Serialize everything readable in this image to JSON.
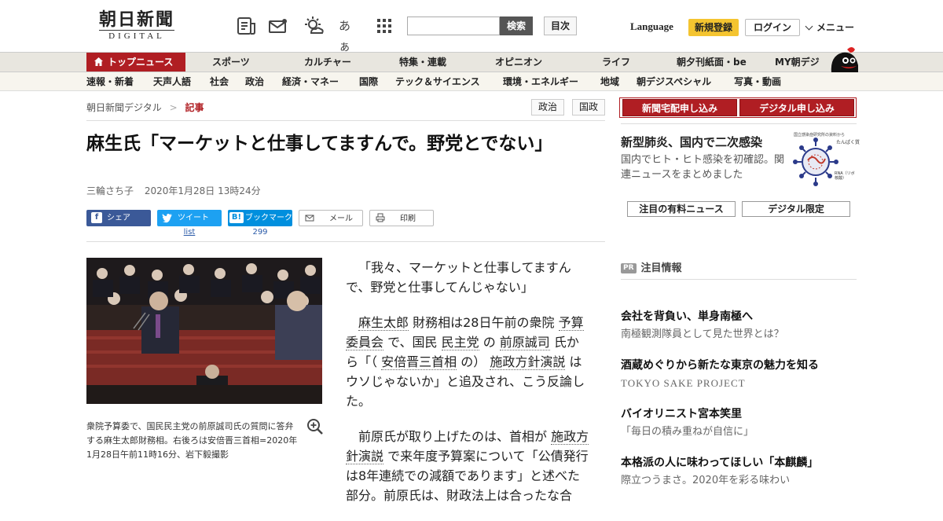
{
  "header": {
    "logo_jp": "朝日新聞",
    "logo_en": "DIGITAL",
    "icons": [
      "newspaper-icon",
      "mail-icon",
      "weather-icon",
      "font-size-icon",
      "grid-menu-icon"
    ],
    "font_icon_text": "あぁ",
    "search_placeholder": "",
    "search_label": "検索",
    "index_label": "目次",
    "language_label": "Language",
    "signup_label": "新規登録",
    "login_label": "ログイン",
    "menu_label": "メニュー"
  },
  "nav_primary": {
    "top": "トップニュース",
    "items": [
      "スポーツ",
      "カルチャー",
      "特集・連載",
      "オピニオン",
      "ライフ",
      "朝夕刊紙面・be",
      "MY朝デジ"
    ]
  },
  "nav_secondary": [
    "速報・新着",
    "天声人語",
    "社会",
    "政治",
    "経済・マネー",
    "国際",
    "テック＆サイエンス",
    "環境・エネルギー",
    "地域",
    "朝デジスペシャル",
    "写真・動画"
  ],
  "breadcrumb": {
    "home": "朝日新聞デジタル",
    "sep": ">",
    "current": "記事"
  },
  "tags": [
    "政治",
    "国政"
  ],
  "article": {
    "title": "麻生氏「マーケットと仕事してますんで。野党とでない」",
    "author": "三輪さち子",
    "date": "2020年1月28日 13時24分",
    "share": {
      "facebook": "シェア",
      "twitter": "ツイート",
      "twitter_count": "list",
      "hatena": "ブックマーク",
      "hatena_count": "299",
      "mail": "メール",
      "print": "印刷"
    },
    "caption": "衆院予算委で、国民民主党の前原誠司氏の質問に答弁する麻生太郎財務相。右後ろは安倍晋三首相=2020年1月28日午前11時16分、岩下毅撮影",
    "p1": "「我々、マーケットと仕事してますんで、野党と仕事してんじゃない」",
    "p2": {
      "a": "麻生太郎",
      "b": "財務相は28日午前の衆院",
      "c": "予算委員会",
      "d": "で、国民",
      "e": "民主党",
      "f": "の",
      "g": "前原誠司",
      "h": "氏から「（",
      "i": "安倍晋三首相",
      "j": "の）",
      "k": "施政方針演説",
      "l": "はウソじゃないか」と追及され、こう反論した。"
    },
    "p3": {
      "a": "前原氏が取り上げたのは、首相が",
      "b": "施政方針演説",
      "c": "で来年度予算案について「公債発行は8年連続での減額であります」と述べた部分。前原氏は、財政法上は合ったな合"
    }
  },
  "sidebar": {
    "subscribe_paper": "新聞宅配申し込み",
    "subscribe_digital": "デジタル申し込み",
    "promo_title": "新型肺炎、国内で二次感染",
    "promo_text": "国内でヒト・ヒト感染を初確認。関連ニュースをまとめました",
    "virus_label_top": "国立感染症研究所の資料から",
    "virus_label_protein": "たんぱく質",
    "virus_label_rna": "RNA（リボ核酸）",
    "btn_premium": "注目の有料ニュース",
    "btn_digital": "デジタル限定",
    "pr_badge": "PR",
    "pr_title": "注目情報",
    "ads": [
      {
        "h": "会社を背負い、単身南極へ",
        "s": "南極観測隊員として見た世界とは？"
      },
      {
        "h": "酒蔵めぐりから新たな東京の魅力を知る",
        "s": "TOKYO SAKE PROJECT"
      },
      {
        "h": "バイオリニスト宮本笑里",
        "s": "「毎日の積み重ねが自信に」"
      },
      {
        "h": "本格派の人に味わってほしい「本麒麟」",
        "s": "際立つうまさ。2020年を彩る味わい"
      }
    ]
  },
  "colors": {
    "brand_red": "#b01e23",
    "signup_yellow": "#f4c430",
    "facebook": "#3b5998",
    "twitter": "#1da1f2",
    "hatena": "#008fde"
  }
}
